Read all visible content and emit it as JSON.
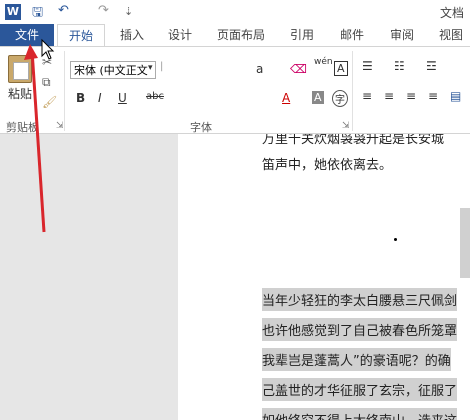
{
  "titlebar": {
    "app_icon": "W",
    "save_glyph": "🖫",
    "undo_glyph": "↶",
    "redo_glyph": "↷",
    "customize_glyph": "⇣",
    "doc_title": "文档"
  },
  "tabs": [
    {
      "label": "文件"
    },
    {
      "label": "开始"
    },
    {
      "label": "插入"
    },
    {
      "label": "设计"
    },
    {
      "label": "页面布局"
    },
    {
      "label": "引用"
    },
    {
      "label": "邮件"
    },
    {
      "label": "审阅"
    },
    {
      "label": "视图"
    }
  ],
  "ribbon": {
    "paste_label": "粘贴",
    "clipboard_group": "剪贴板",
    "font_group": "字体",
    "font_name": "宋体 (中文正文",
    "font_size_glyph": "a",
    "bold": "B",
    "italic": "I",
    "underline": "U",
    "strike": "abc",
    "font_color": "A",
    "char_shading": "A",
    "enclose_char": "字",
    "phonetic": "wén",
    "text_border": "A"
  },
  "document": {
    "line_top": "万里千关炊烟袅袅升起是长安城",
    "line_1": "笛声中，她依依离去。",
    "line_2": "当年少轻狂的李太白腰悬三尺佩剑",
    "line_3": "也许他感觉到了自己被春色所笼罩",
    "line_4": "我辈岂是蓬蒿人”的豪语呢？的确",
    "line_5": "己盖世的才华征服了玄宗，征服了",
    "line_6": "如他终究不得上太终南山，选来这"
  },
  "colors": {
    "accent": "#2b579a",
    "annotation_arrow": "#d9262c"
  }
}
